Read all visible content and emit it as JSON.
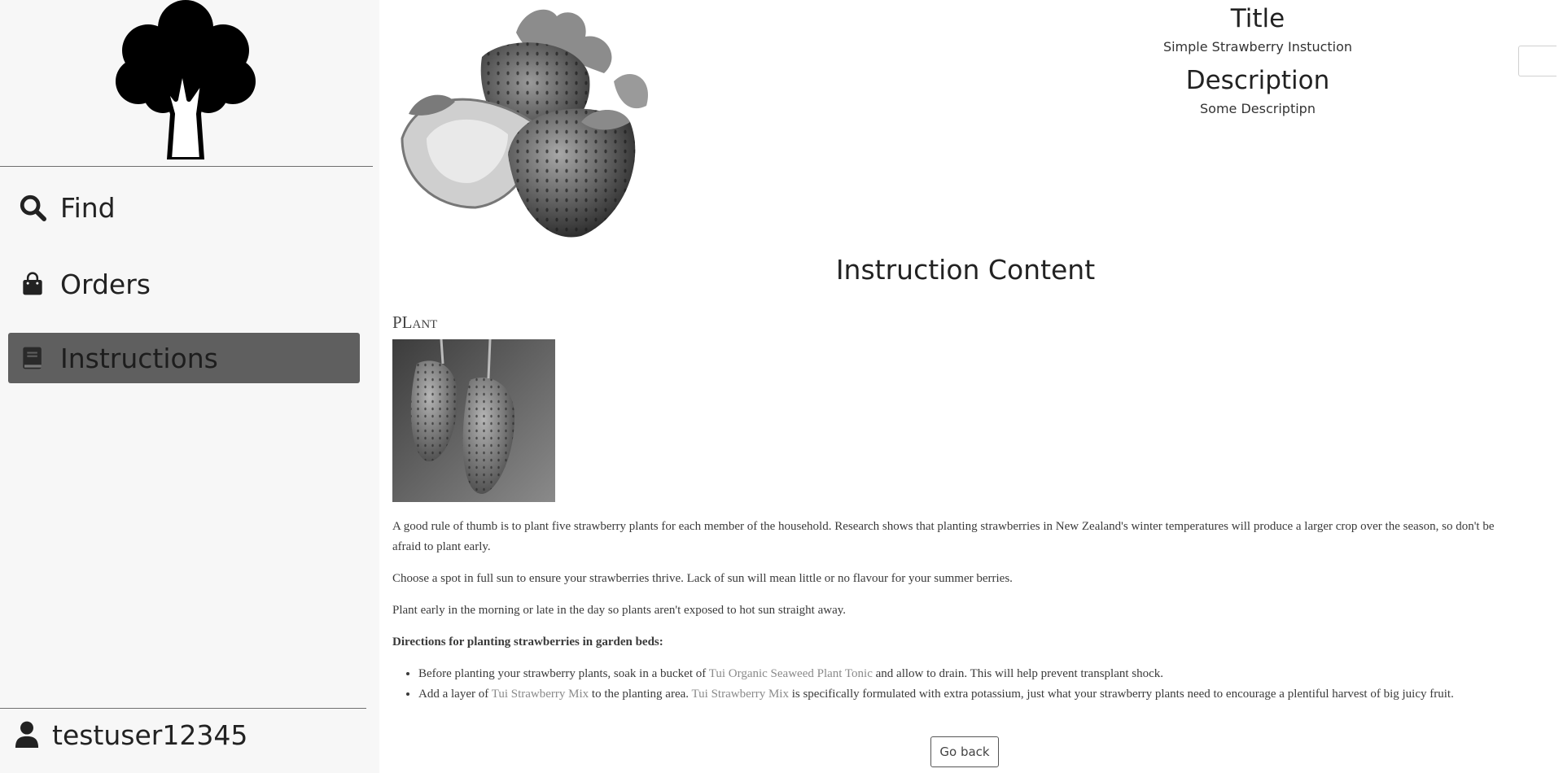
{
  "sidebar": {
    "logo_icon": "tree-icon",
    "items": [
      {
        "label": "Find",
        "icon": "search-icon"
      },
      {
        "label": "Orders",
        "icon": "shopping-bag-icon"
      },
      {
        "label": "Instructions",
        "icon": "book-icon",
        "active": true
      }
    ],
    "user": {
      "name": "testuser12345",
      "icon": "user-icon"
    }
  },
  "header": {
    "title_label": "Title",
    "title_value": "Simple Strawberry Instuction",
    "description_label": "Description",
    "description_value": "Some Descriptipn"
  },
  "content": {
    "heading": "Instruction Content",
    "section_title": "PLant",
    "paragraphs": [
      "A good rule of thumb is to plant five strawberry plants for each member of the household. Research shows that planting strawberries in New Zealand's winter temperatures will produce a larger crop over the season, so don't be afraid to plant early.",
      "Choose a spot in full sun to ensure your strawberries thrive. Lack of sun will mean little or no flavour for your summer berries.",
      "Plant early in the morning or late in the day so plants aren't exposed to hot sun straight away."
    ],
    "directions_heading": "Directions for planting strawberries in garden beds:",
    "list": [
      {
        "before": "Before planting your strawberry plants, soak in a bucket of ",
        "link": "Tui Organic Seaweed Plant Tonic",
        "after": " and allow to drain. This will help prevent transplant shock."
      },
      {
        "before": "Add a layer of ",
        "link": "Tui Strawberry Mix",
        "middle": " to the planting area. ",
        "link2": "Tui Strawberry Mix",
        "after": " is specifically formulated with extra potassium, just what your strawberry plants need to encourage a plentiful harvest of big juicy fruit."
      }
    ]
  },
  "actions": {
    "go_back_label": "Go back"
  },
  "colors": {
    "sidebar_bg": "#f7f7f7",
    "active_item_bg": "#5f5f5f",
    "link": "#8a8a8a"
  }
}
